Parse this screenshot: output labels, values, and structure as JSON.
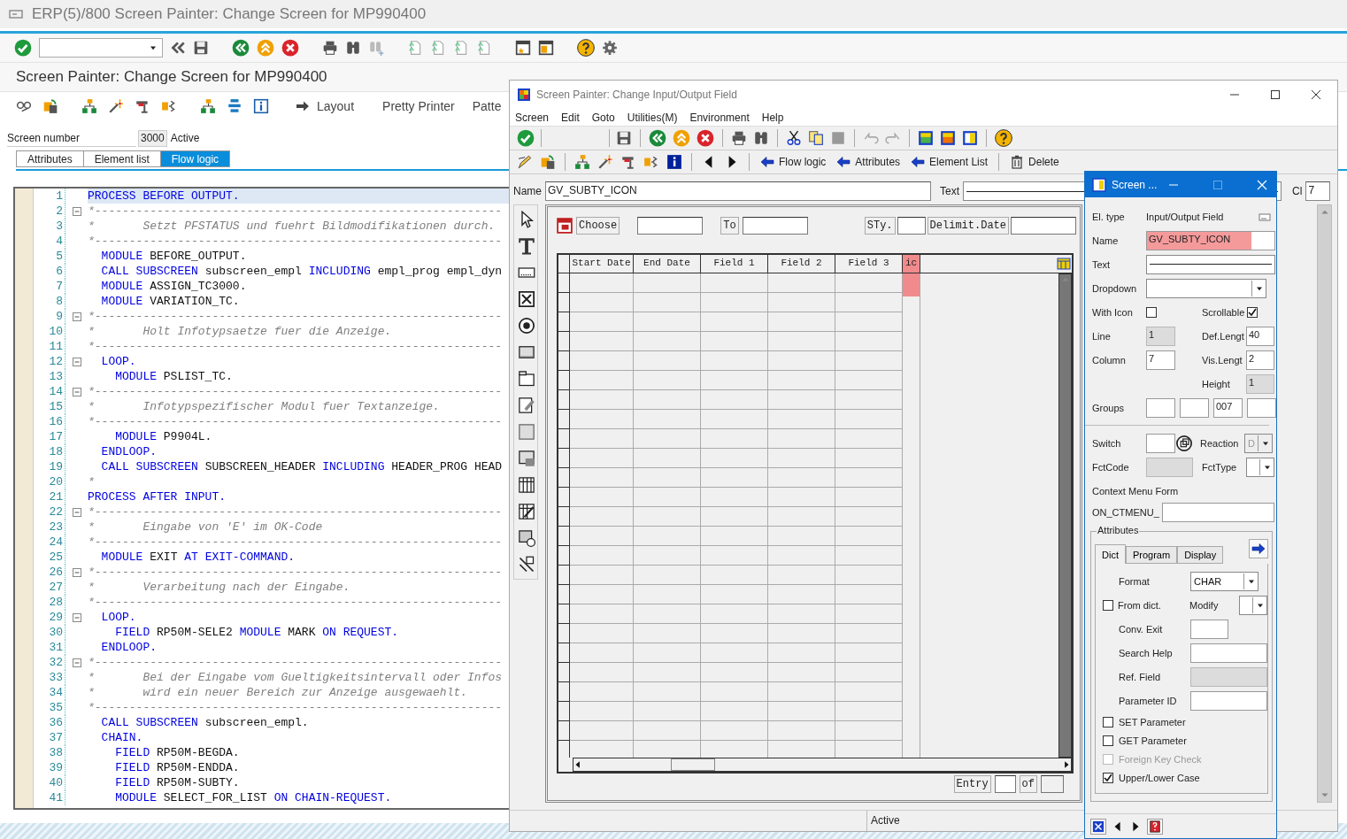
{
  "window": {
    "title": "ERP(5)/800 Screen Painter: Change Screen for MP990400"
  },
  "page_title": "Screen Painter: Change Screen for MP990400",
  "app_toolbar": [
    {
      "label": "Layout",
      "kind": "navigate"
    },
    {
      "label": "Pretty Printer",
      "kind": "plain"
    },
    {
      "label": "Patte",
      "kind": "plain"
    }
  ],
  "screen": {
    "label": "Screen number",
    "number": "3000",
    "status": "Active"
  },
  "tabs": [
    {
      "label": "Attributes",
      "selected": false
    },
    {
      "label": "Element list",
      "selected": false
    },
    {
      "label": "Flow logic",
      "selected": true
    }
  ],
  "editor": {
    "lines": [
      {
        "number": "1",
        "fold": false,
        "current": true,
        "tokens": [
          {
            "kind": "kw",
            "text": "PROCESS BEFORE OUTPUT."
          }
        ]
      },
      {
        "number": "2",
        "fold": true,
        "current": false,
        "tokens": [
          {
            "kind": "cm",
            "text": "*-----------------------------------------------------------"
          }
        ]
      },
      {
        "number": "3",
        "fold": false,
        "current": false,
        "tokens": [
          {
            "kind": "cm",
            "text": "*       Setzt PFSTATUS und fuehrt Bildmodifikationen durch."
          }
        ]
      },
      {
        "number": "4",
        "fold": false,
        "current": false,
        "tokens": [
          {
            "kind": "cm",
            "text": "*-----------------------------------------------------------"
          }
        ]
      },
      {
        "number": "5",
        "fold": false,
        "current": false,
        "tokens": [
          {
            "kind": "kw",
            "text": "  MODULE"
          },
          {
            "kind": "id",
            "text": " BEFORE_OUTPUT."
          }
        ]
      },
      {
        "number": "6",
        "fold": false,
        "current": false,
        "tokens": [
          {
            "kind": "kw",
            "text": "  CALL SUBSCREEN"
          },
          {
            "kind": "id",
            "text": " subscreen_empl "
          },
          {
            "kind": "kw",
            "text": "INCLUDING"
          },
          {
            "kind": "id",
            "text": " empl_prog empl_dyn"
          }
        ]
      },
      {
        "number": "7",
        "fold": false,
        "current": false,
        "tokens": [
          {
            "kind": "kw",
            "text": "  MODULE"
          },
          {
            "kind": "id",
            "text": " ASSIGN_TC3000."
          }
        ]
      },
      {
        "number": "8",
        "fold": false,
        "current": false,
        "tokens": [
          {
            "kind": "kw",
            "text": "  MODULE"
          },
          {
            "kind": "id",
            "text": " VARIATION_TC."
          }
        ]
      },
      {
        "number": "9",
        "fold": true,
        "current": false,
        "tokens": [
          {
            "kind": "cm",
            "text": "*-----------------------------------------------------------"
          }
        ]
      },
      {
        "number": "10",
        "fold": false,
        "current": false,
        "tokens": [
          {
            "kind": "cm",
            "text": "*       Holt Infotypsaetze fuer die Anzeige."
          }
        ]
      },
      {
        "number": "11",
        "fold": false,
        "current": false,
        "tokens": [
          {
            "kind": "cm",
            "text": "*-----------------------------------------------------------"
          }
        ]
      },
      {
        "number": "12",
        "fold": true,
        "current": false,
        "tokens": [
          {
            "kind": "kw",
            "text": "  LOOP."
          }
        ]
      },
      {
        "number": "13",
        "fold": false,
        "current": false,
        "tokens": [
          {
            "kind": "kw",
            "text": "    MODULE"
          },
          {
            "kind": "id",
            "text": " PSLIST_TC."
          }
        ]
      },
      {
        "number": "14",
        "fold": true,
        "current": false,
        "tokens": [
          {
            "kind": "cm",
            "text": "*-----------------------------------------------------------"
          }
        ]
      },
      {
        "number": "15",
        "fold": false,
        "current": false,
        "tokens": [
          {
            "kind": "cm",
            "text": "*       Infotypspezifischer Modul fuer Textanzeige."
          }
        ]
      },
      {
        "number": "16",
        "fold": false,
        "current": false,
        "tokens": [
          {
            "kind": "cm",
            "text": "*-----------------------------------------------------------"
          }
        ]
      },
      {
        "number": "17",
        "fold": false,
        "current": false,
        "tokens": [
          {
            "kind": "kw",
            "text": "    MODULE"
          },
          {
            "kind": "id",
            "text": " P9904L."
          }
        ]
      },
      {
        "number": "18",
        "fold": false,
        "current": false,
        "tokens": [
          {
            "kind": "kw",
            "text": "  ENDLOOP."
          }
        ]
      },
      {
        "number": "19",
        "fold": false,
        "current": false,
        "tokens": [
          {
            "kind": "kw",
            "text": "  CALL SUBSCREEN"
          },
          {
            "kind": "id",
            "text": " SUBSCREEN_HEADER "
          },
          {
            "kind": "kw",
            "text": "INCLUDING"
          },
          {
            "kind": "id",
            "text": " HEADER_PROG HEAD"
          }
        ]
      },
      {
        "number": "20",
        "fold": false,
        "current": false,
        "tokens": [
          {
            "kind": "cm",
            "text": "*"
          }
        ]
      },
      {
        "number": "21",
        "fold": false,
        "current": false,
        "tokens": [
          {
            "kind": "kw",
            "text": "PROCESS AFTER INPUT."
          }
        ]
      },
      {
        "number": "22",
        "fold": true,
        "current": false,
        "tokens": [
          {
            "kind": "cm",
            "text": "*-----------------------------------------------------------"
          }
        ]
      },
      {
        "number": "23",
        "fold": false,
        "current": false,
        "tokens": [
          {
            "kind": "cm",
            "text": "*       Eingabe von 'E' im OK-Code"
          }
        ]
      },
      {
        "number": "24",
        "fold": false,
        "current": false,
        "tokens": [
          {
            "kind": "cm",
            "text": "*-----------------------------------------------------------"
          }
        ]
      },
      {
        "number": "25",
        "fold": false,
        "current": false,
        "tokens": [
          {
            "kind": "kw",
            "text": "  MODULE"
          },
          {
            "kind": "id",
            "text": " EXIT "
          },
          {
            "kind": "kw",
            "text": "AT EXIT-COMMAND."
          }
        ]
      },
      {
        "number": "26",
        "fold": true,
        "current": false,
        "tokens": [
          {
            "kind": "cm",
            "text": "*-----------------------------------------------------------"
          }
        ]
      },
      {
        "number": "27",
        "fold": false,
        "current": false,
        "tokens": [
          {
            "kind": "cm",
            "text": "*       Verarbeitung nach der Eingabe."
          }
        ]
      },
      {
        "number": "28",
        "fold": false,
        "current": false,
        "tokens": [
          {
            "kind": "cm",
            "text": "*-----------------------------------------------------------"
          }
        ]
      },
      {
        "number": "29",
        "fold": true,
        "current": false,
        "tokens": [
          {
            "kind": "kw",
            "text": "  LOOP."
          }
        ]
      },
      {
        "number": "30",
        "fold": false,
        "current": false,
        "tokens": [
          {
            "kind": "kw",
            "text": "    FIELD"
          },
          {
            "kind": "id",
            "text": " RP50M-SELE2 "
          },
          {
            "kind": "kw",
            "text": "MODULE"
          },
          {
            "kind": "id",
            "text": " MARK "
          },
          {
            "kind": "kw",
            "text": "ON REQUEST."
          }
        ]
      },
      {
        "number": "31",
        "fold": false,
        "current": false,
        "tokens": [
          {
            "kind": "kw",
            "text": "  ENDLOOP."
          }
        ]
      },
      {
        "number": "32",
        "fold": true,
        "current": false,
        "tokens": [
          {
            "kind": "cm",
            "text": "*-----------------------------------------------------------"
          }
        ]
      },
      {
        "number": "33",
        "fold": false,
        "current": false,
        "tokens": [
          {
            "kind": "cm",
            "text": "*       Bei der Eingabe vom Gueltigkeitsintervall oder Infos"
          }
        ]
      },
      {
        "number": "34",
        "fold": false,
        "current": false,
        "tokens": [
          {
            "kind": "cm",
            "text": "*       wird ein neuer Bereich zur Anzeige ausgewaehlt."
          }
        ]
      },
      {
        "number": "35",
        "fold": false,
        "current": false,
        "tokens": [
          {
            "kind": "cm",
            "text": "*-----------------------------------------------------------"
          }
        ]
      },
      {
        "number": "36",
        "fold": false,
        "current": false,
        "tokens": [
          {
            "kind": "kw",
            "text": "  CALL SUBSCREEN"
          },
          {
            "kind": "id",
            "text": " subscreen_empl."
          }
        ]
      },
      {
        "number": "37",
        "fold": false,
        "current": false,
        "tokens": [
          {
            "kind": "kw",
            "text": "  CHAIN."
          }
        ]
      },
      {
        "number": "38",
        "fold": false,
        "current": false,
        "tokens": [
          {
            "kind": "kw",
            "text": "    FIELD"
          },
          {
            "kind": "id",
            "text": " RP50M-BEGDA."
          }
        ]
      },
      {
        "number": "39",
        "fold": false,
        "current": false,
        "tokens": [
          {
            "kind": "kw",
            "text": "    FIELD"
          },
          {
            "kind": "id",
            "text": " RP50M-ENDDA."
          }
        ]
      },
      {
        "number": "40",
        "fold": false,
        "current": false,
        "tokens": [
          {
            "kind": "kw",
            "text": "    FIELD"
          },
          {
            "kind": "id",
            "text": " RP50M-SUBTY."
          }
        ]
      },
      {
        "number": "41",
        "fold": false,
        "current": false,
        "tokens": [
          {
            "kind": "kw",
            "text": "    MODULE"
          },
          {
            "kind": "id",
            "text": " SELECT_FOR_LIST "
          },
          {
            "kind": "kw",
            "text": "ON CHAIN-REQUEST."
          }
        ]
      }
    ]
  },
  "painter": {
    "title": "Screen Painter:  Change Input/Output Field",
    "menu": [
      "Screen",
      "Edit",
      "Goto",
      "Utilities(M)",
      "Environment",
      "Help"
    ],
    "toolbar_buttons": [
      {
        "label": "Flow logic",
        "kind": "navigate"
      },
      {
        "label": "Attributes",
        "kind": "navigate"
      },
      {
        "label": "Element List",
        "kind": "navigate"
      },
      {
        "label": "Delete",
        "kind": "delete"
      }
    ],
    "name_label": "Name",
    "name_value": "GV_SUBTY_ICON",
    "text_label": "Text",
    "cl_label": "Cl",
    "cl_value": "7",
    "header_left": [
      {
        "kind": "picker"
      },
      {
        "kind": "label",
        "text": "Choose"
      },
      {
        "kind": "input"
      },
      {
        "kind": "label",
        "text": "To"
      },
      {
        "kind": "input"
      }
    ],
    "header_right": [
      {
        "kind": "label",
        "text": "STy."
      },
      {
        "kind": "input"
      },
      {
        "kind": "label",
        "text": "Delimit.Date"
      },
      {
        "kind": "input"
      }
    ],
    "columns": [
      {
        "label": "Start Date",
        "selected": false
      },
      {
        "label": "End Date",
        "selected": false
      },
      {
        "label": "Field 1",
        "selected": false
      },
      {
        "label": "Field 2",
        "selected": false
      },
      {
        "label": "Field 3",
        "selected": false
      },
      {
        "label": "ic",
        "selected": true
      }
    ],
    "footer": [
      {
        "kind": "label",
        "text": "Entry"
      },
      {
        "kind": "input"
      },
      {
        "kind": "label",
        "text": "of"
      },
      {
        "kind": "box"
      }
    ],
    "status": "Active"
  },
  "dialog": {
    "title": "Screen ...",
    "el_type": {
      "label": "El. type",
      "value": "Input/Output Field"
    },
    "name": {
      "label": "Name",
      "value": "GV_SUBTY_ICON",
      "highlighted": true
    },
    "text": {
      "label": "Text"
    },
    "dropdown": {
      "label": "Dropdown"
    },
    "with_icon": {
      "label": "With Icon",
      "checked": false
    },
    "scrollable": {
      "label": "Scrollable",
      "checked": true
    },
    "line": {
      "label": "Line",
      "value": "1",
      "disabled": true
    },
    "def_length": {
      "label": "Def.Lengt",
      "value": "40",
      "disabled": false
    },
    "column": {
      "label": "Column",
      "value": "7",
      "disabled": false
    },
    "vis_length": {
      "label": "Vis.Lengt",
      "value": "2",
      "disabled": false
    },
    "height": {
      "label": "Height",
      "value": "1",
      "disabled": true
    },
    "groups": {
      "label": "Groups",
      "group_3": "007"
    },
    "switch": {
      "label": "Switch"
    },
    "reaction": {
      "label": "Reaction",
      "value": "D",
      "disabled": true
    },
    "fct_code": {
      "label": "FctCode",
      "disabled": true
    },
    "fct_type": {
      "label": "FctType"
    },
    "context_menu": {
      "label": "Context Menu Form",
      "prefix": "ON_CTMENU_"
    },
    "attributes": {
      "legend": "Attributes",
      "tabs": [
        {
          "label": "Dict",
          "selected": true
        },
        {
          "label": "Program",
          "selected": false
        },
        {
          "label": "Display",
          "selected": false
        }
      ],
      "format": {
        "label": "Format",
        "value": "CHAR"
      },
      "from_dict": {
        "label": "From dict.",
        "checked": false
      },
      "modify": {
        "label": "Modify"
      },
      "fields": [
        {
          "label": "Conv. Exit",
          "disabled": false
        },
        {
          "label": "Search Help",
          "disabled": false
        },
        {
          "label": "Ref. Field",
          "disabled": true
        },
        {
          "label": "Parameter ID",
          "disabled": false
        }
      ],
      "options": [
        {
          "label": "SET Parameter",
          "checked": false,
          "disabled": false
        },
        {
          "label": "GET Parameter",
          "checked": false,
          "disabled": false
        },
        {
          "label": "Foreign Key Check",
          "checked": false,
          "disabled": true
        },
        {
          "label": "Upper/Lower Case",
          "checked": true,
          "disabled": false
        }
      ]
    }
  }
}
